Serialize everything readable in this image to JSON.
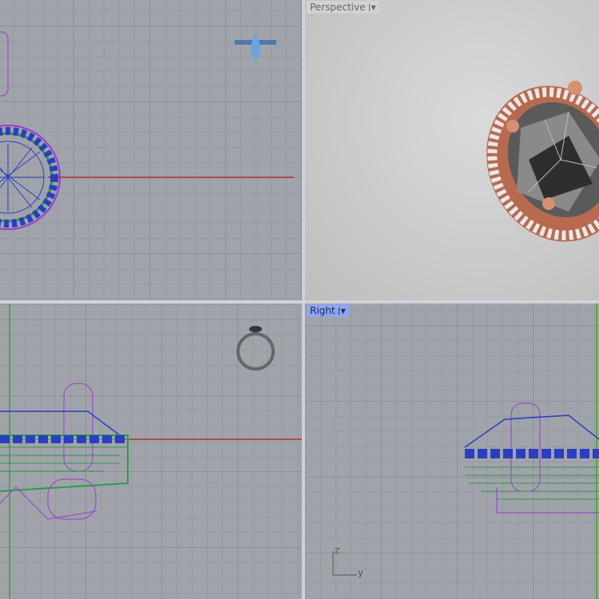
{
  "viewports": {
    "top": {
      "label": ""
    },
    "perspective": {
      "label": "Perspective",
      "dropdown_icon": "caret-down-icon"
    },
    "front": {
      "label": ""
    },
    "right": {
      "label": "Right",
      "dropdown_icon": "caret-down-icon",
      "axis": {
        "z": "z",
        "y": "y"
      }
    }
  },
  "colors": {
    "x_axis": "#b03030",
    "y_axis": "#2fae2f",
    "wire_blue": "#2a3ec0",
    "wire_purple": "#9a3ad0",
    "wire_green": "#2f9a4a",
    "rose_gold": "#d08868"
  }
}
